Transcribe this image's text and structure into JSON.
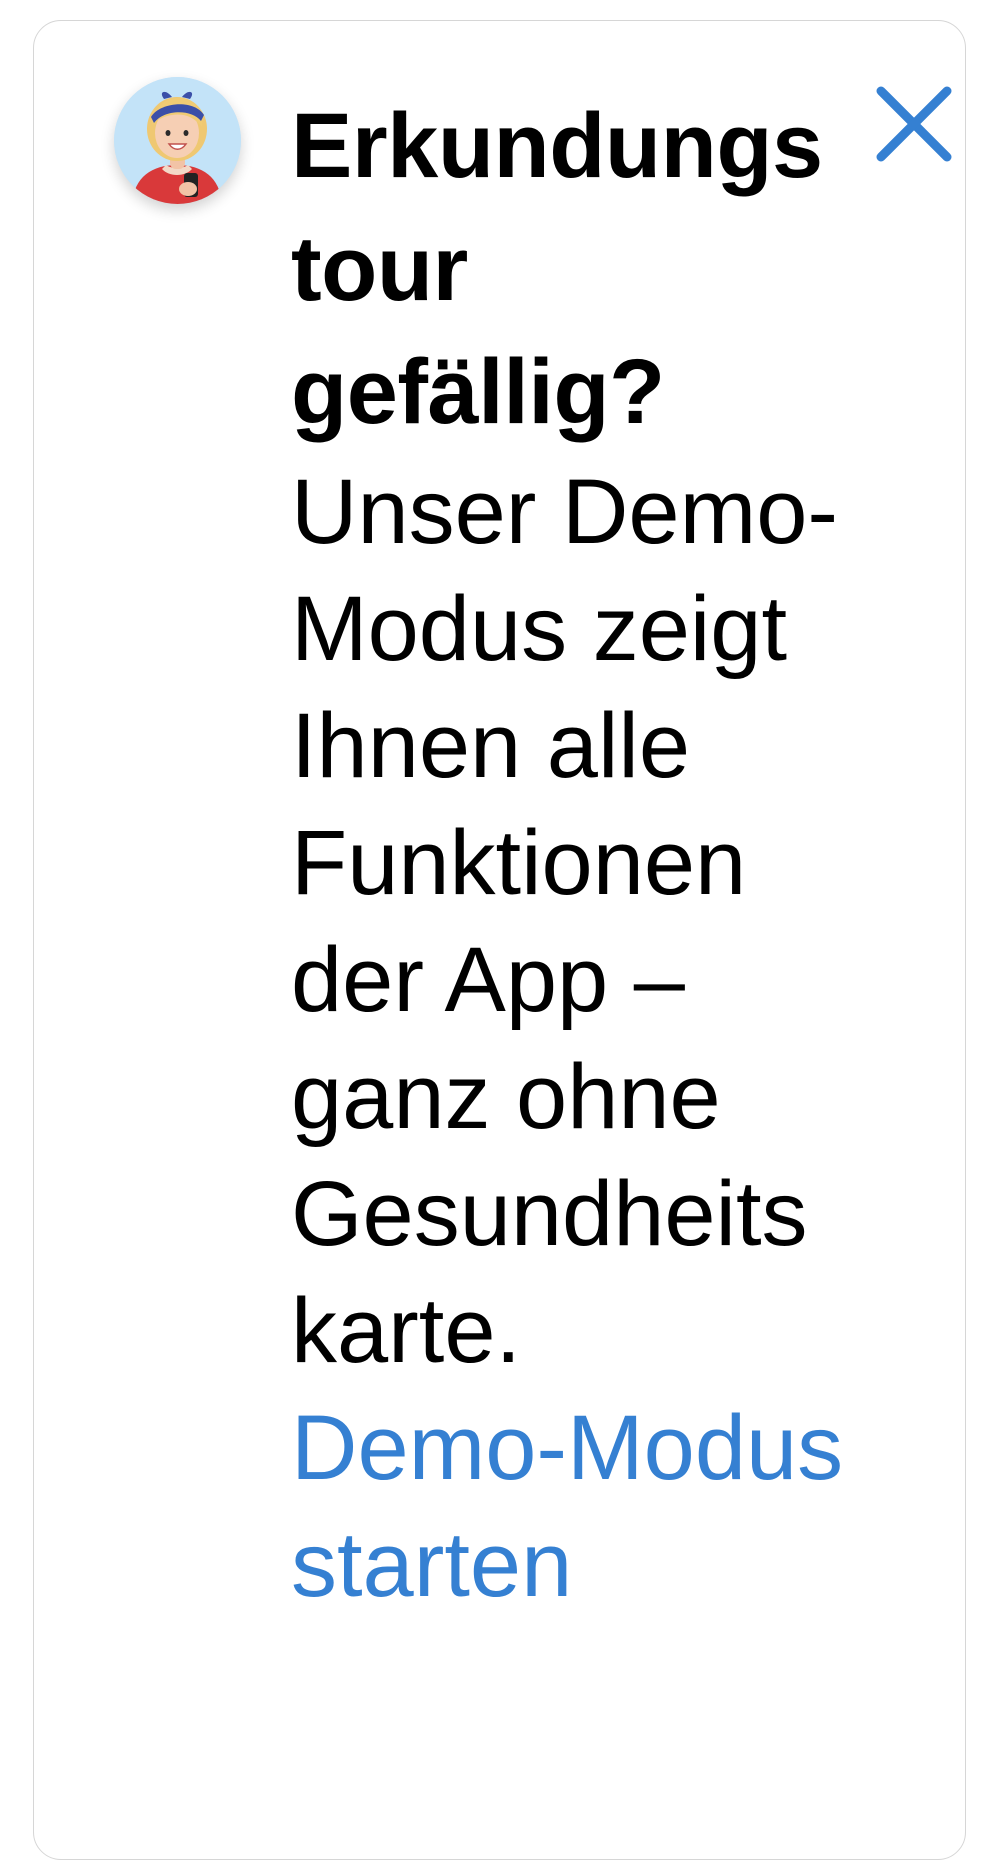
{
  "banner": {
    "avatar_icon": "woman-avatar-icon",
    "title": "Erkundungstour gefällig?",
    "body": "Unser Demo-Modus zeigt Ihnen alle Funktionen der App – ganz ohne Gesundheitskarte.",
    "link_label": "Demo-Modus starten",
    "close_icon": "close-icon"
  },
  "colors": {
    "accent": "#3580d2",
    "border": "#d6d6d6",
    "text": "#000000",
    "background": "#ffffff"
  }
}
